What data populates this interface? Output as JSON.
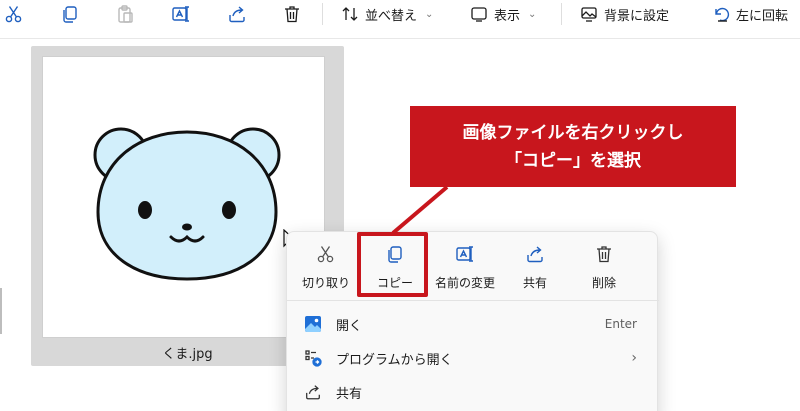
{
  "toolbar": {
    "sort_label": "並べ替え",
    "view_label": "表示",
    "set_background_label": "背景に設定",
    "rotate_left_label": "左に回転"
  },
  "file": {
    "name": "くま.jpg"
  },
  "context_menu": {
    "quick_actions": [
      {
        "label": "切り取り",
        "icon": "scissors-icon"
      },
      {
        "label": "コピー",
        "icon": "copy-icon"
      },
      {
        "label": "名前の変更",
        "icon": "rename-icon"
      },
      {
        "label": "共有",
        "icon": "share-icon"
      },
      {
        "label": "削除",
        "icon": "trash-icon"
      }
    ],
    "items": [
      {
        "label": "開く",
        "shortcut": "Enter",
        "icon": "photos-app-icon"
      },
      {
        "label": "プログラムから開く",
        "icon": "open-with-icon"
      },
      {
        "label": "共有",
        "icon": "share-icon"
      }
    ]
  },
  "callout": {
    "line1": "画像ファイルを右クリックし",
    "line2": "「コピー」を選択"
  },
  "colors": {
    "accent_red": "#c8161d",
    "bear_fill": "#d2effb",
    "icon_blue": "#1f6fd6"
  }
}
